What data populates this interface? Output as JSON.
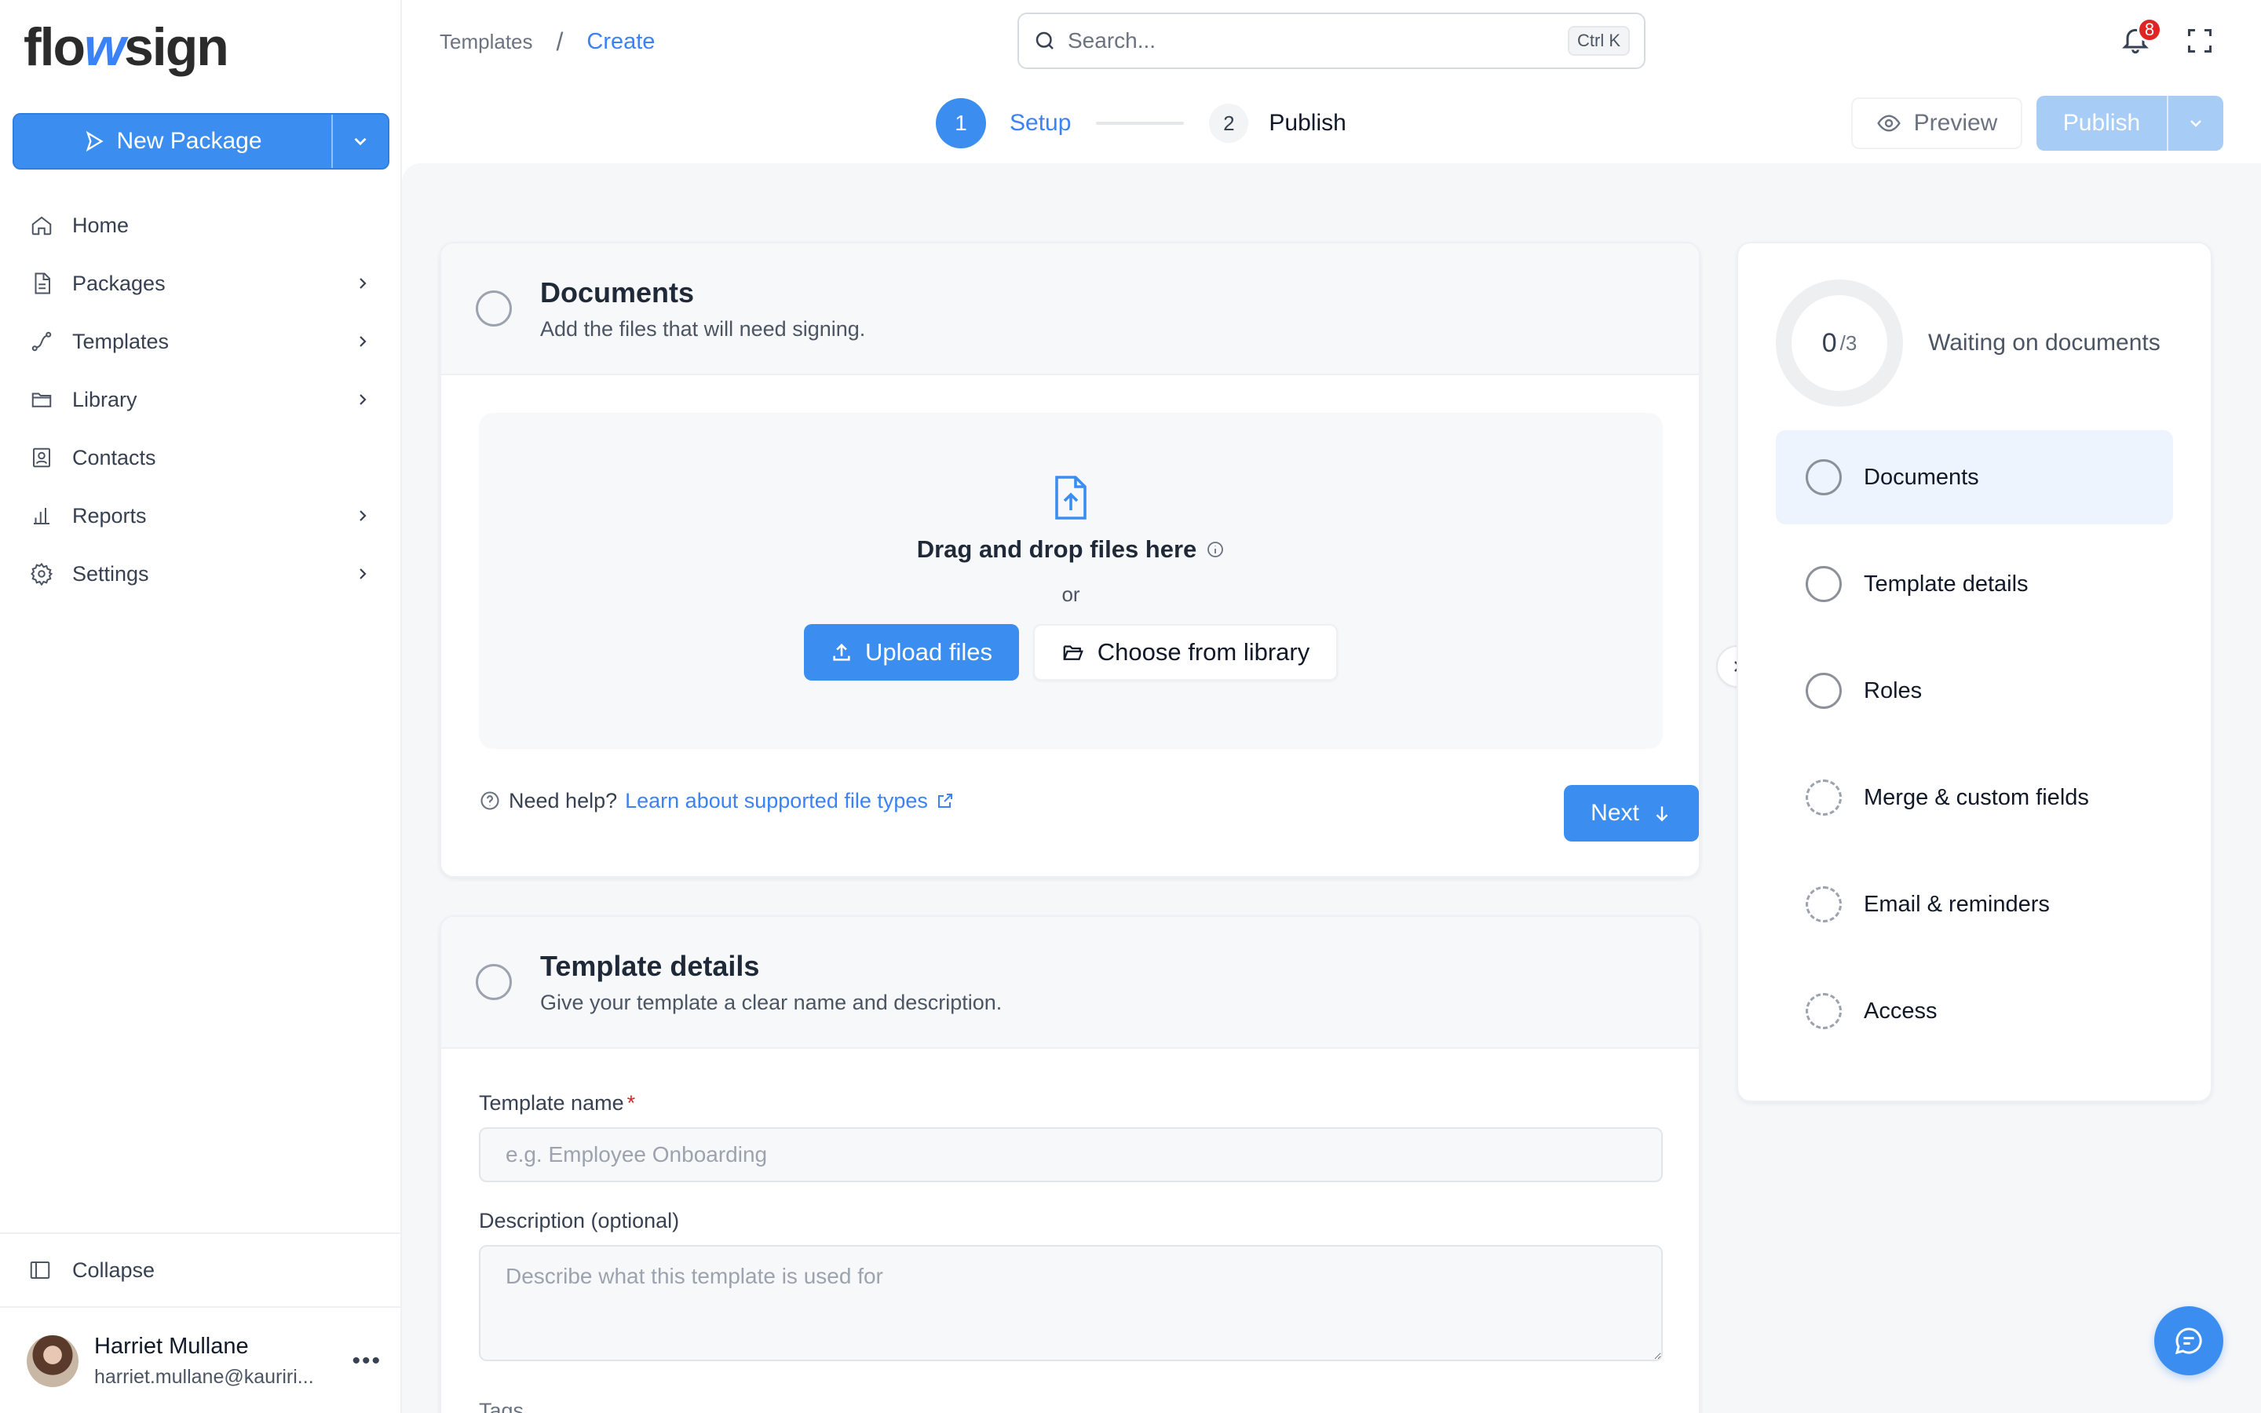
{
  "app": {
    "logo_prefix": "flo",
    "logo_accent": "w",
    "logo_suffix": "sign"
  },
  "sidebar": {
    "new_package_label": "New Package",
    "items": [
      {
        "label": "Home",
        "icon": "home-icon",
        "has_children": false
      },
      {
        "label": "Packages",
        "icon": "document-icon",
        "has_children": true
      },
      {
        "label": "Templates",
        "icon": "route-icon",
        "has_children": true
      },
      {
        "label": "Library",
        "icon": "folder-icon",
        "has_children": true
      },
      {
        "label": "Contacts",
        "icon": "contact-card-icon",
        "has_children": false
      },
      {
        "label": "Reports",
        "icon": "bar-chart-icon",
        "has_children": true
      },
      {
        "label": "Settings",
        "icon": "gear-icon",
        "has_children": true
      }
    ],
    "collapse_label": "Collapse",
    "user": {
      "name": "Harriet Mullane",
      "email": "harriet.mullane@kauriri..."
    }
  },
  "header": {
    "breadcrumb": [
      "Templates",
      "Create"
    ],
    "breadcrumb_sep": "/",
    "search_placeholder": "Search...",
    "search_shortcut": "Ctrl K",
    "notification_count": "8"
  },
  "stepper": {
    "steps": [
      {
        "number": "1",
        "label": "Setup",
        "active": true
      },
      {
        "number": "2",
        "label": "Publish",
        "active": false
      }
    ]
  },
  "actions": {
    "preview_label": "Preview",
    "publish_label": "Publish"
  },
  "documents_section": {
    "title": "Documents",
    "subtitle": "Add the files that will need signing.",
    "drop_title": "Drag and drop files here",
    "drop_or": "or",
    "upload_label": "Upload files",
    "library_label": "Choose from library",
    "help_prefix": "Need help?",
    "help_link": "Learn about supported file types",
    "next_label": "Next"
  },
  "template_details_section": {
    "title": "Template details",
    "subtitle": "Give your template a clear name and description.",
    "name_label": "Template name",
    "name_required": "*",
    "name_placeholder": "e.g. Employee Onboarding",
    "description_label": "Description (optional)",
    "description_placeholder": "Describe what this template is used for",
    "tags_label": "Tags"
  },
  "progress": {
    "done": "0",
    "total": "/3",
    "status": "Waiting on documents",
    "items": [
      {
        "label": "Documents",
        "active": true,
        "style": "solid"
      },
      {
        "label": "Template details",
        "active": false,
        "style": "solid"
      },
      {
        "label": "Roles",
        "active": false,
        "style": "solid"
      },
      {
        "label": "Merge & custom fields",
        "active": false,
        "style": "dashed"
      },
      {
        "label": "Email & reminders",
        "active": false,
        "style": "dashed"
      },
      {
        "label": "Access",
        "active": false,
        "style": "dashed"
      }
    ]
  },
  "colors": {
    "primary": "#3b8ef0",
    "publish_disabled": "#a7cdf7",
    "badge": "#e02424",
    "active_item_bg": "#eef4fd"
  }
}
